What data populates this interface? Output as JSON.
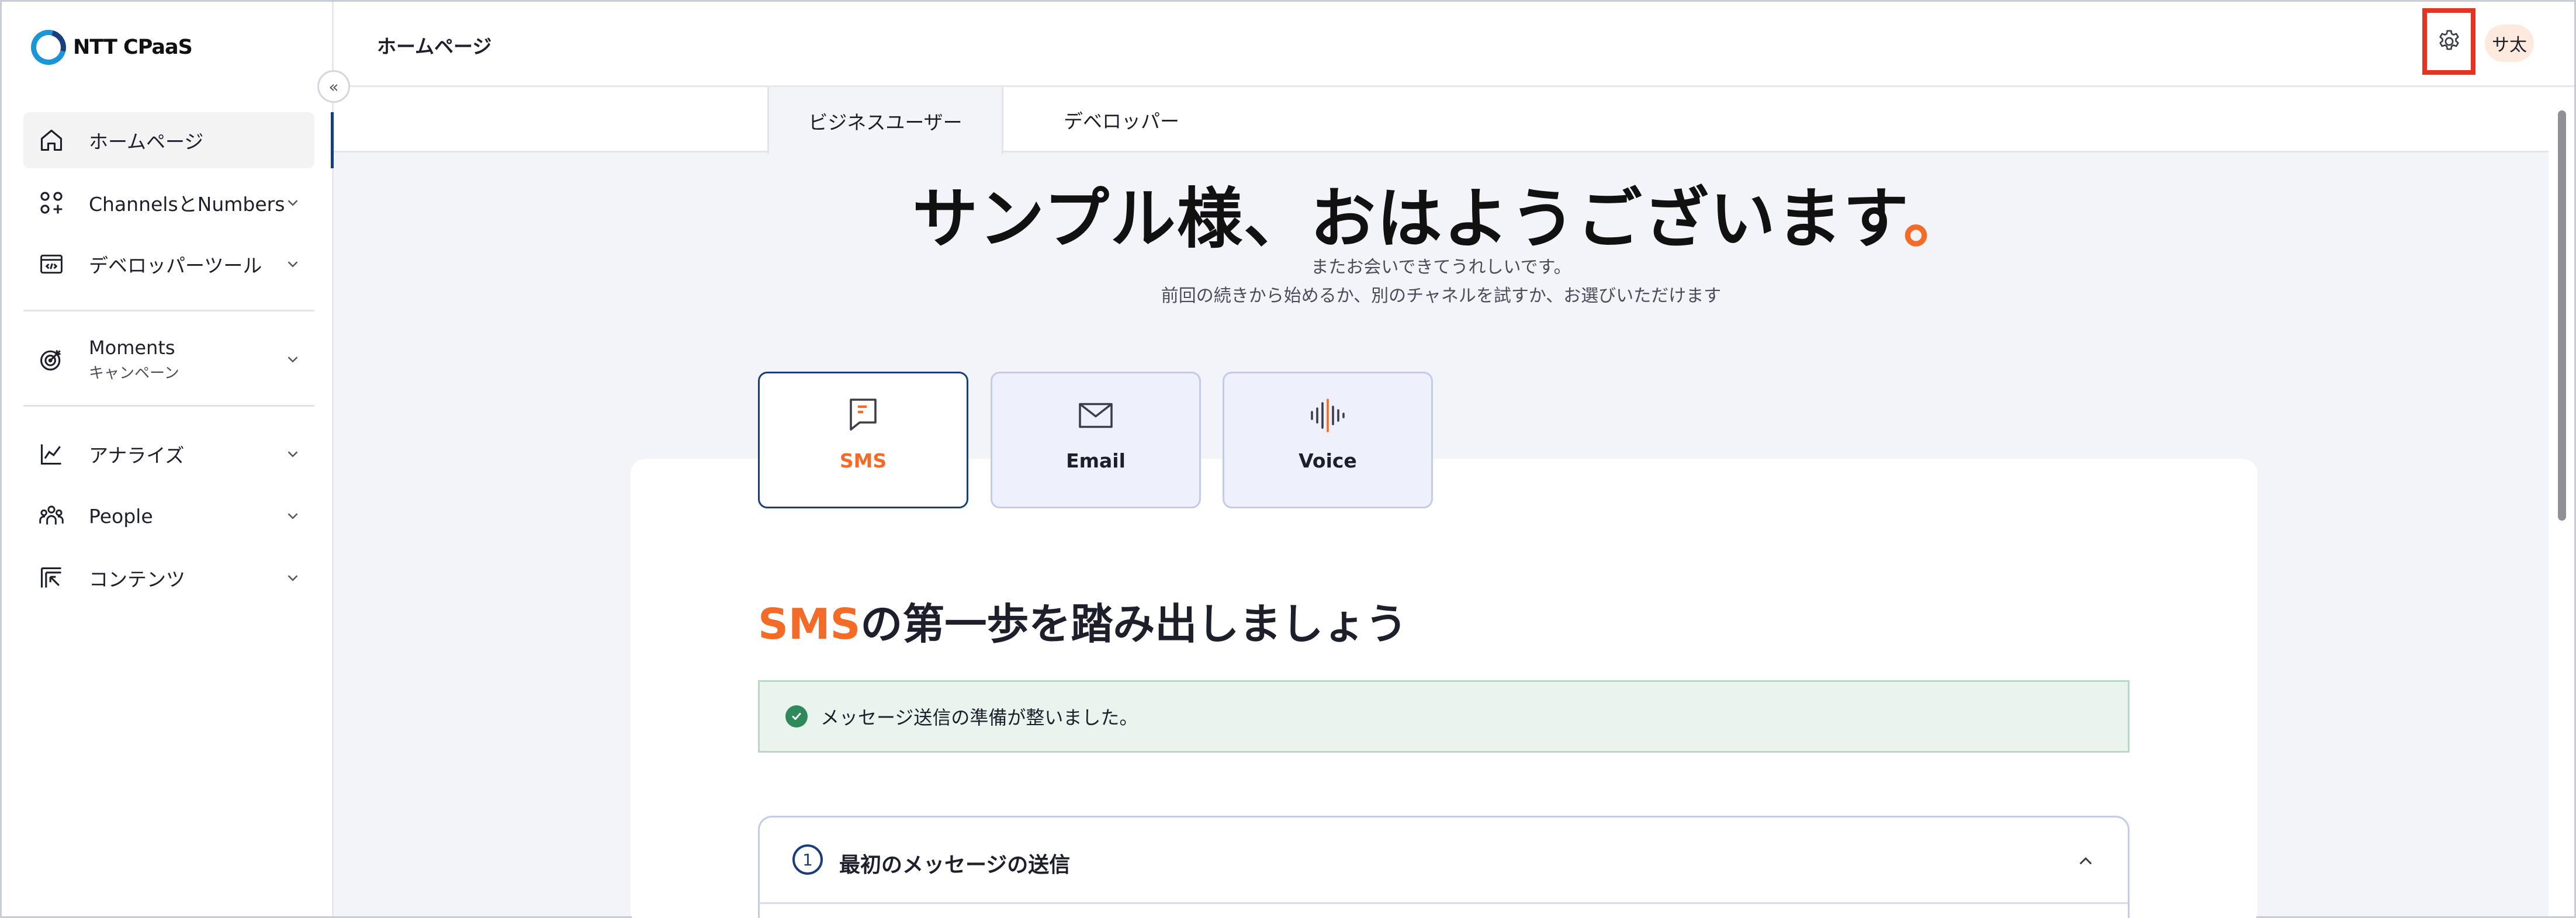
{
  "brand": {
    "name": "NTT CPaaS"
  },
  "colors": {
    "accent": "#f36b27",
    "primary": "#1a3e7d",
    "success": "#2e8a5a",
    "highlight": "#e8321f"
  },
  "sidebar": {
    "collapse_icon": "double-chevron-left-icon",
    "collapse_glyph": "«",
    "items": [
      {
        "label": "ホームページ",
        "icon": "home-icon",
        "active": true
      },
      {
        "label": "ChannelsとNumbers",
        "icon": "apps-grid-icon"
      },
      {
        "label": "デベロッパーツール",
        "icon": "code-icon"
      },
      {
        "label": "Moments",
        "sublabel": "キャンペーン",
        "icon": "target-icon"
      },
      {
        "label": "アナライズ",
        "icon": "chart-line-icon"
      },
      {
        "label": "People",
        "icon": "people-icon"
      },
      {
        "label": "コンテンツ",
        "icon": "content-icon"
      }
    ]
  },
  "header": {
    "title": "ホームページ",
    "settings_icon": "gear-icon",
    "avatar_initials": "サ太"
  },
  "tabs": [
    {
      "label": "ビジネスユーザー",
      "active": true
    },
    {
      "label": "デベロッパー",
      "active": false
    }
  ],
  "hero": {
    "greeting": "サンプル様、おはようございます",
    "greeting_dot": "。",
    "subtitle_1": "またお会いできてうれしいです。",
    "subtitle_2": "前回の続きから始めるか、別のチャネルを試すか、お選びいただけます"
  },
  "channels": [
    {
      "label": "SMS",
      "icon": "sms-icon",
      "active": true
    },
    {
      "label": "Email",
      "icon": "mail-icon",
      "active": false
    },
    {
      "label": "Voice",
      "icon": "voice-wave-icon",
      "active": false
    }
  ],
  "getting_started": {
    "title_highlight": "SMS",
    "title_rest": "の第一歩を踏み出しましょう",
    "alert_icon": "check-circle-icon",
    "alert_text": "メッセージ送信の準備が整いました。",
    "steps": [
      {
        "number": "1",
        "title": "最初のメッセージの送信",
        "expanded": true,
        "chevron_icon": "chevron-up-icon"
      }
    ]
  }
}
